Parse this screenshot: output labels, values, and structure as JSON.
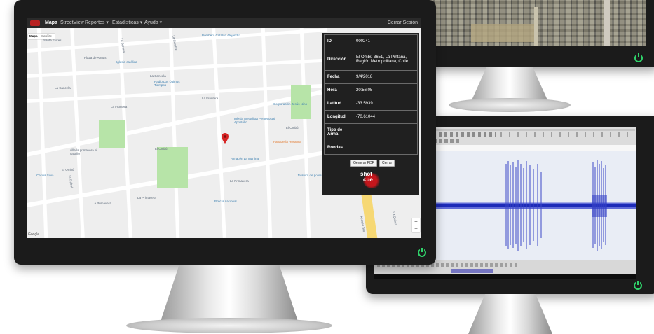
{
  "navbar": {
    "logo_icon": "shotcue-logo-icon",
    "items": [
      "Mapa",
      "StreetView",
      "Reportes ▾",
      "Estadísticas ▾",
      "Ayuda ▾"
    ],
    "logout": "Cerrar Sesión"
  },
  "map": {
    "type_buttons": [
      "Mapa",
      "Satélite"
    ],
    "labels": {
      "villa_flores": "Santa Flores",
      "plaza_armas": "Plaza de Armas",
      "iglesia": "Iglesia católica",
      "la_cancela": "La Cancela",
      "radio": "Radio Los Últimos Tiempos",
      "la_frontera_1": "La Frontera",
      "la_frontera_2": "La Frontera",
      "bomberos": "Bombero Catalan Alejandro",
      "corporacion": "Corporación Jesús Nino",
      "iglesia_metodista": "Iglesia Metodista Pentecostal Apostólic...",
      "el_ombu_1": "El Ombú",
      "el_ombu_2": "El Ombú",
      "el_ombu_3": "El Ombú",
      "panaderia": "Panadería Hosanna",
      "almacen": "Almacén La Martina",
      "villa_primavera": "villa la primavera el castillo",
      "cecilia": "Cecilia Silva",
      "la_primavera_1": "La Primavera",
      "la_primavera_2": "La Primavera",
      "la_primavera_3": "La Primavera",
      "jefatura": "Jefatura de policía",
      "policia": "Policía nacional",
      "acceso_sur": "Acceso Sur",
      "la_quinta": "La Quinta",
      "la_serena": "La Serena",
      "la_cumbre": "La Cumbre",
      "el_trebol": "El Trebol",
      "google": "Google"
    },
    "zoom": [
      "+",
      "−"
    ]
  },
  "info_panel": {
    "rows": [
      {
        "key": "ID",
        "value": "000241"
      },
      {
        "key": "Dirección",
        "value": "El Ombú 3651, La Pintana, Región Metropolitana, Chile"
      },
      {
        "key": "Fecha",
        "value": "9/4/2018"
      },
      {
        "key": "Hora",
        "value": "20:56:05"
      },
      {
        "key": "Latitud",
        "value": "-33.5939"
      },
      {
        "key": "Longitud",
        "value": "-70.61044"
      },
      {
        "key": "Tipo de Arma",
        "value": ""
      },
      {
        "key": "Rondas",
        "value": ""
      }
    ],
    "generate_pdf": "Generar PDF",
    "close": "Cerrar",
    "logo_line1": "shot",
    "logo_line2": "cue"
  },
  "colors": {
    "bezel": "#1b1b1b",
    "power": "#2fd26a",
    "map_bg": "#eeeeee",
    "park": "#b7e4a8",
    "wave": "#2431c8",
    "marker": "#d62424"
  }
}
